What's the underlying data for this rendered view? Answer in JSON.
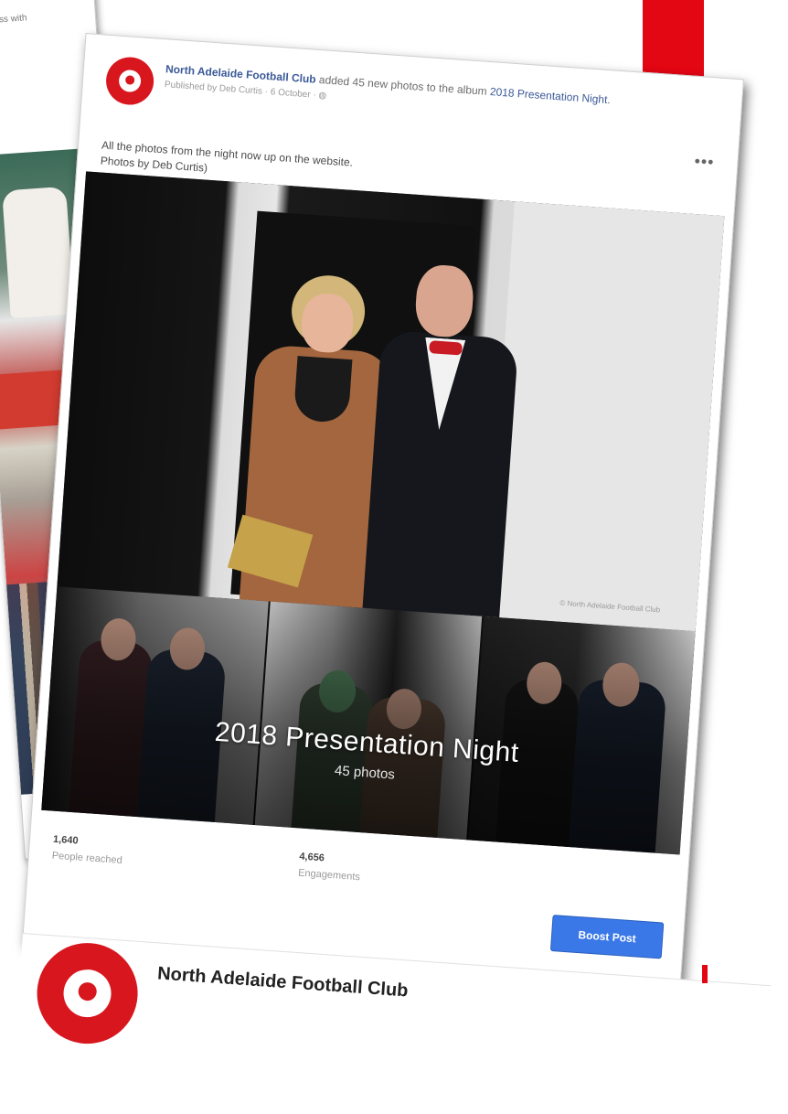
{
  "left_card": {
    "snippet_text": "ss with"
  },
  "post": {
    "page_name": "North Adelaide Football Club",
    "action_text": "added 45 new photos to the album",
    "album_name": "2018 Presentation Night",
    "published_by": "Published by Deb Curtis",
    "date": "6 October",
    "more_label": "•••",
    "body_line1": "All the photos from the night now up on the website.",
    "body_line2": "Photos by Deb Curtis)",
    "watermark": "© North Adelaide Football Club",
    "album_title": "2018 Presentation Night",
    "photo_count": "45 photos"
  },
  "stats": {
    "reached_value": "1,640",
    "reached_label": "People reached",
    "engagements_value": "4,656",
    "engagements_label": "Engagements"
  },
  "boost_button": "Boost Post",
  "next_post": {
    "page_name": "North Adelaide Football Club"
  },
  "colors": {
    "brand_red": "#d8161e",
    "link_blue": "#3b5998",
    "button_blue": "#3b78e7"
  }
}
